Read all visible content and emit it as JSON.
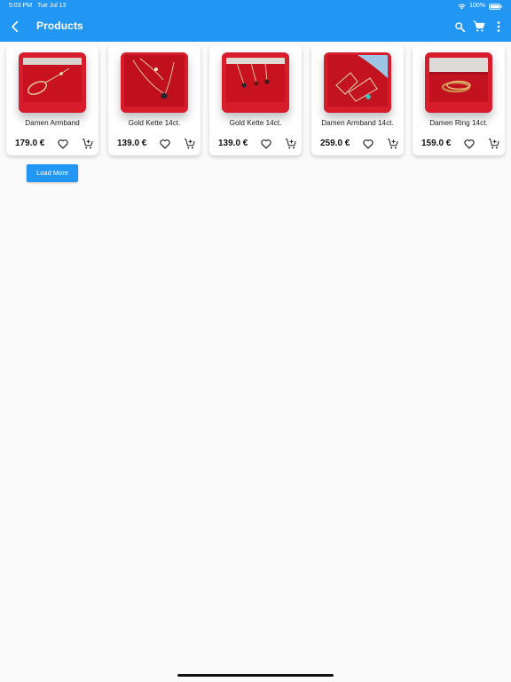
{
  "status_bar": {
    "time": "5:03 PM",
    "date": "Tue Jul 13",
    "battery": "100%"
  },
  "app_bar": {
    "title": "Products",
    "icons": [
      "back-icon",
      "search-icon",
      "cart-icon",
      "more-vert-icon"
    ]
  },
  "products": [
    {
      "name": "Damen Armband",
      "price": "179.0 €"
    },
    {
      "name": "Gold Kette 14ct.",
      "price": "139.0 €"
    },
    {
      "name": "Gold Kette 14ct.",
      "price": "139.0 €"
    },
    {
      "name": "Damen Armband 14ct.",
      "price": "259.0 €"
    },
    {
      "name": "Damen Ring 14ct.",
      "price": "159.0 €"
    }
  ],
  "load_more_label": "Load More",
  "colors": {
    "primary": "#2196f3",
    "background": "#fafafa",
    "card": "#ffffff",
    "product_background_red": "#d71d2c"
  }
}
